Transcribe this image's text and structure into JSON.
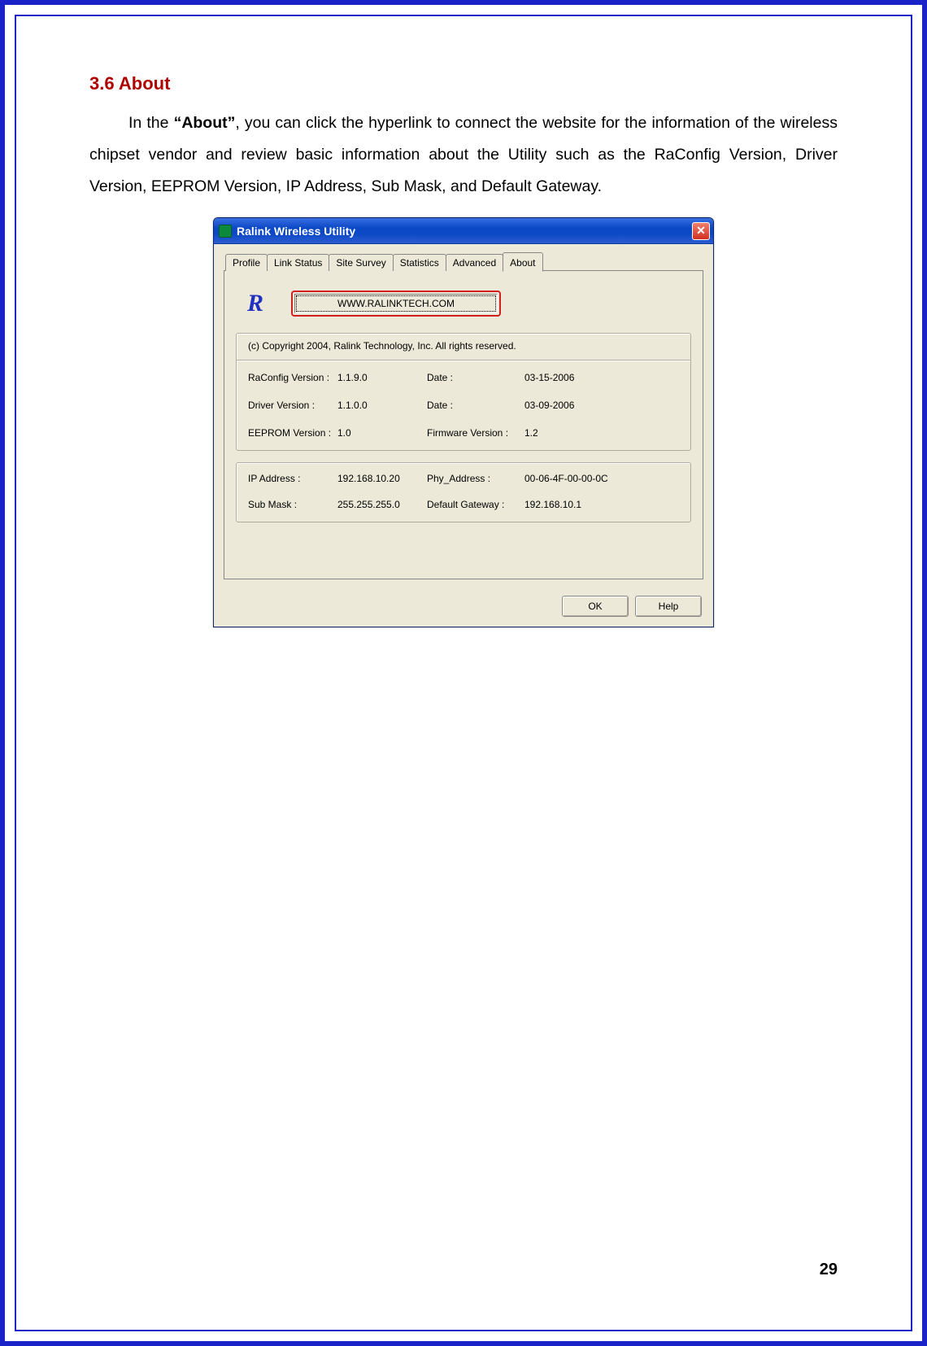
{
  "doc": {
    "section_heading": "3.6  About",
    "para_before": "In the ",
    "para_bold": "“About”",
    "para_after": ", you can click the hyperlink to connect the website for the information of the wireless chipset vendor and review basic information about the Utility such as the RaConfig Version, Driver Version, EEPROM Version, IP Address, Sub Mask, and Default Gateway.",
    "page_number": "29"
  },
  "dialog": {
    "title": "Ralink Wireless Utility",
    "close_glyph": "✕",
    "tabs": {
      "profile": "Profile",
      "link_status": "Link Status",
      "site_survey": "Site Survey",
      "statistics": "Statistics",
      "advanced": "Advanced",
      "about": "About"
    },
    "logo_text": "R",
    "hyperlink": "WWW.RALINKTECH.COM",
    "copyright": "(c) Copyright 2004, Ralink Technology, Inc.  All rights reserved.",
    "versions": {
      "raconfig_label": "RaConfig Version :",
      "raconfig_value": "1.1.9.0",
      "raconfig_date_label": "Date :",
      "raconfig_date_value": "03-15-2006",
      "driver_label": "Driver Version :",
      "driver_value": "1.1.0.0",
      "driver_date_label": "Date :",
      "driver_date_value": "03-09-2006",
      "eeprom_label": "EEPROM Version :",
      "eeprom_value": "1.0",
      "firmware_label": "Firmware Version :",
      "firmware_value": "1.2"
    },
    "network": {
      "ip_label": "IP Address :",
      "ip_value": "192.168.10.20",
      "phy_label": "Phy_Address :",
      "phy_value": "00-06-4F-00-00-0C",
      "mask_label": "Sub Mask :",
      "mask_value": "255.255.255.0",
      "gw_label": "Default Gateway :",
      "gw_value": "192.168.10.1"
    },
    "buttons": {
      "ok": "OK",
      "help": "Help"
    }
  }
}
